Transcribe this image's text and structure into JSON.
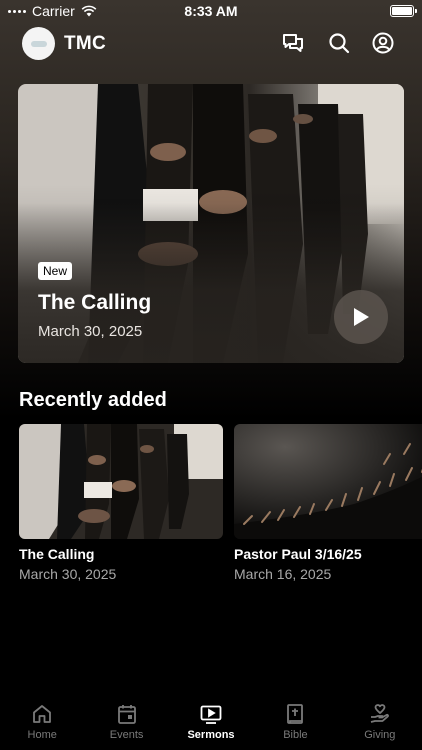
{
  "status_bar": {
    "carrier": "Carrier",
    "time": "8:33 AM",
    "battery_level": 1.0
  },
  "header": {
    "title": "TMC",
    "logo": "church-logo",
    "icons": [
      "chat-icon",
      "search-icon",
      "account-icon"
    ]
  },
  "hero": {
    "badge": "New",
    "title": "The Calling",
    "date": "March 30, 2025",
    "action_icon": "play-icon"
  },
  "recently_added": {
    "title": "Recently added",
    "items": [
      {
        "title": "The Calling",
        "date": "March 30, 2025"
      },
      {
        "title": "Pastor Paul 3/16/25",
        "date": "March 16, 2025"
      }
    ]
  },
  "tabs": [
    {
      "label": "Home",
      "icon": "home-icon",
      "active": false
    },
    {
      "label": "Events",
      "icon": "calendar-icon",
      "active": false
    },
    {
      "label": "Sermons",
      "icon": "video-icon",
      "active": true
    },
    {
      "label": "Bible",
      "icon": "bible-icon",
      "active": false
    },
    {
      "label": "Giving",
      "icon": "giving-icon",
      "active": false
    }
  ],
  "colors": {
    "background": "#000000",
    "tab_inactive": "#7a7a7a",
    "tab_active": "#ffffff"
  }
}
